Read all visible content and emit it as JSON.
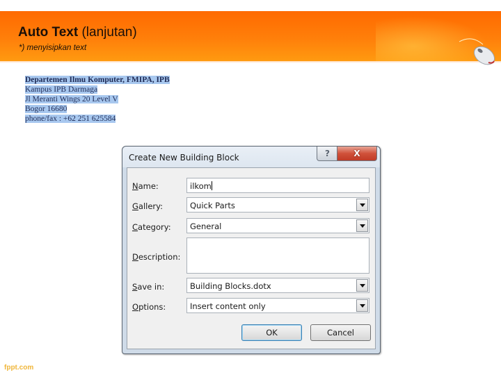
{
  "slide": {
    "title_bold": "Auto Text",
    "title_rest": "(lanjutan)",
    "subtitle": "*) menyisipkan text",
    "footer_brand": "fppt.com",
    "accent_color": "#ff7f0a",
    "decoration": "computer-mouse-icon"
  },
  "document_snippet": {
    "lines": [
      "Departemen Ilmu Komputer, FMIPA, IPB",
      "Kampus IPB Darmaga",
      "Jl Meranti Wings 20 Level V",
      "Bogor 16680",
      "phone/fax : +62 251 625584"
    ],
    "highlight_color": "#a8c8ef"
  },
  "dialog": {
    "title": "Create New Building Block",
    "help_label": "?",
    "close_label": "X",
    "fields": {
      "name": {
        "label_key": "N",
        "label_rest": "ame:",
        "value": "ilkom"
      },
      "gallery": {
        "label_key": "G",
        "label_rest": "allery:",
        "value": "Quick Parts"
      },
      "category": {
        "label_key": "C",
        "label_rest": "ategory:",
        "value": "General"
      },
      "description": {
        "label_key": "D",
        "label_rest": "escription:",
        "value": ""
      },
      "save_in": {
        "label_key": "S",
        "label_rest": "ave in:",
        "value": "Building Blocks.dotx"
      },
      "options": {
        "label_key": "O",
        "label_rest": "ptions:",
        "value": "Insert content only"
      }
    },
    "ok_label": "OK",
    "cancel_label": "Cancel"
  }
}
